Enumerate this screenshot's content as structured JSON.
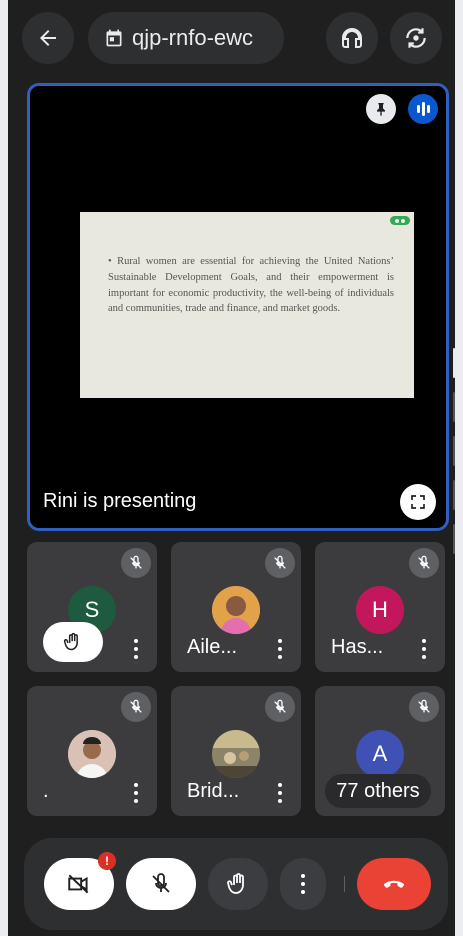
{
  "header": {
    "back_icon": "arrow-back-icon",
    "meeting_code": "qjp-rnfo-ewc",
    "calendar_icon": "calendar-icon",
    "audio_output_icon": "headphones-icon",
    "switch_camera_icon": "switch-camera-icon"
  },
  "stage": {
    "slide_text": "• Rural women are essential for achieving the United Nations’ Sustainable Development Goals, and their empowerment is important for economic productivity, the well-being of individuals and communities, trade and finance, and market goods.",
    "presenter_label": "Rini is presenting",
    "pin_icon": "pin-icon",
    "speaking_icon": "audio-level-icon",
    "fullscreen_icon": "fullscreen-icon",
    "border_color": "#2f5fbf"
  },
  "participants": [
    {
      "name": "",
      "avatar_letter": "S",
      "avatar_color": "#1e5a3d",
      "muted": true,
      "hand_raised": true
    },
    {
      "name": "Aile...",
      "avatar_letter": "",
      "avatar_color": "#d07ab0",
      "muted": true
    },
    {
      "name": "Has...",
      "avatar_letter": "H",
      "avatar_color": "#c2185b",
      "muted": true
    },
    {
      "name": ".",
      "avatar_letter": "",
      "avatar_color": "#c98f74",
      "muted": true
    },
    {
      "name": "Brid...",
      "avatar_letter": "",
      "avatar_color": "#6f6650",
      "muted": true
    },
    {
      "name": "",
      "avatar_letter": "A",
      "avatar_color": "#3f51b5",
      "muted": true,
      "others_label": "77 others"
    }
  ],
  "controls": {
    "camera_icon": "camera-off-icon",
    "camera_badge": "!",
    "mic_icon": "mic-off-icon",
    "hand_icon": "raise-hand-icon",
    "more_icon": "more-vert-icon",
    "end_call_icon": "end-call-icon",
    "end_call_color": "#ea4335"
  }
}
